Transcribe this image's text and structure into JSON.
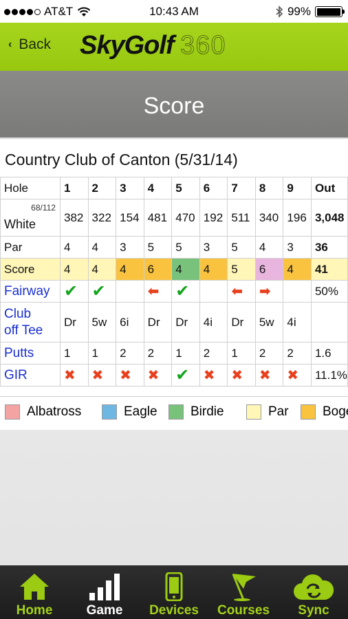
{
  "status_bar": {
    "carrier": "AT&T",
    "time": "10:43 AM",
    "battery": "99%",
    "battery_level": 0.99
  },
  "header": {
    "back_label": "Back",
    "logo_text_1": "SkyGolf",
    "logo_text_2": "360"
  },
  "page_title": "Score",
  "course_title": "Country Club of Canton (5/31/14)",
  "scorecard": {
    "hole_label": "Hole",
    "holes": [
      "1",
      "2",
      "3",
      "4",
      "5",
      "6",
      "7",
      "8",
      "9"
    ],
    "out_label": "Out",
    "rating": "68/112",
    "tee": "White",
    "yardage": [
      "382",
      "322",
      "154",
      "481",
      "470",
      "192",
      "511",
      "340",
      "196"
    ],
    "yardage_out": "3,048",
    "par_label": "Par",
    "par": [
      "4",
      "4",
      "3",
      "5",
      "5",
      "3",
      "5",
      "4",
      "3"
    ],
    "par_out": "36",
    "score_label": "Score",
    "score": [
      "4",
      "4",
      "4",
      "6",
      "4",
      "4",
      "5",
      "6",
      "4"
    ],
    "score_out": "41",
    "score_result": [
      "par",
      "par",
      "bogey",
      "bogey",
      "birdie",
      "bogey",
      "par",
      "double",
      "bogey"
    ],
    "fairway_label": "Fairway",
    "fairway": [
      "hit",
      "hit",
      "",
      "left",
      "hit",
      "",
      "left",
      "right",
      ""
    ],
    "fairway_out": "50%",
    "club_label_1": "Club",
    "club_label_2": "off Tee",
    "club": [
      "Dr",
      "5w",
      "6i",
      "Dr",
      "Dr",
      "4i",
      "Dr",
      "5w",
      "4i"
    ],
    "putts_label": "Putts",
    "putts": [
      "1",
      "1",
      "2",
      "2",
      "1",
      "2",
      "1",
      "2",
      "2"
    ],
    "putts_out": "1.6",
    "gir_label": "GIR",
    "gir": [
      "miss",
      "miss",
      "miss",
      "miss",
      "hit",
      "miss",
      "miss",
      "miss",
      "miss"
    ],
    "gir_out": "11.1%"
  },
  "legend": [
    {
      "label": "Albatross",
      "color": "#f4a3a3"
    },
    {
      "label": "Eagle",
      "color": "#6fb7e3"
    },
    {
      "label": "Birdie",
      "color": "#78c27c"
    },
    {
      "label": "Par",
      "color": "#fff6b8"
    },
    {
      "label": "Bogey",
      "color": "#f9c33f"
    }
  ],
  "tabs": [
    {
      "label": "Home",
      "icon": "home-icon",
      "active": false
    },
    {
      "label": "Game",
      "icon": "bar-chart-icon",
      "active": true
    },
    {
      "label": "Devices",
      "icon": "phone-icon",
      "active": false
    },
    {
      "label": "Courses",
      "icon": "flag-icon",
      "active": false
    },
    {
      "label": "Sync",
      "icon": "cloud-sync-icon",
      "active": false
    }
  ],
  "colors": {
    "brand_green": "#9bcb12",
    "title_gray": "#818280",
    "label_blue": "#1a2fd1",
    "check_green": "#13a51c",
    "miss_red": "#e8401e"
  }
}
